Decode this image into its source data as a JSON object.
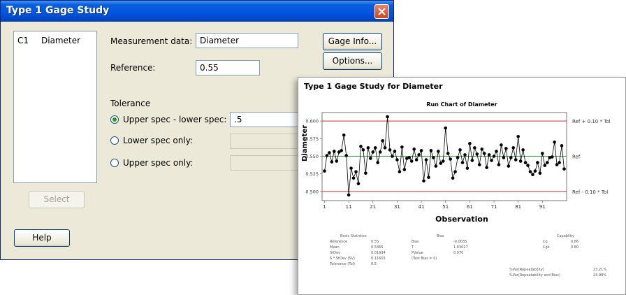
{
  "dialog": {
    "title": "Type 1 Gage Study",
    "variables": [
      {
        "col": "C1",
        "name": "Diameter"
      }
    ],
    "measurement_label": "Measurement data:",
    "measurement_value": "Diameter",
    "reference_label": "Reference:",
    "reference_value": "0.55",
    "tolerance_heading": "Tolerance",
    "opt_upper_lower": "Upper spec - lower spec:",
    "opt_upper_lower_value": ".5",
    "opt_lower_only": "Lower spec only:",
    "opt_upper_only": "Upper spec only:",
    "gage_info_label": "Gage Info...",
    "options_label": "Options...",
    "select_label": "Select",
    "help_label": "Help"
  },
  "graph": {
    "window_title": "Type 1 Gage Study for Diameter",
    "stats": {
      "basic_header": "Basic Statistics",
      "bias_header": "Bias",
      "capability_header": "Capability",
      "basic": [
        {
          "label": "Reference",
          "value": "0.55"
        },
        {
          "label": "Mean",
          "value": "0.5465"
        },
        {
          "label": "StDev",
          "value": "0.01934"
        },
        {
          "label": "6 * StDev (SV)",
          "value": "0.11603"
        },
        {
          "label": "Tolerance (Tol)",
          "value": "0.5"
        }
      ],
      "bias": [
        {
          "label": "Bias",
          "value": "-0.0035"
        },
        {
          "label": "T",
          "value": "1.83027"
        },
        {
          "label": "PValue",
          "value": "0.070"
        },
        {
          "label": "(Test Bias = 0)",
          "value": ""
        }
      ],
      "capability": [
        {
          "label": "Cg",
          "value": "0.86"
        },
        {
          "label": "Cgk",
          "value": "0.80"
        }
      ],
      "var": [
        {
          "label": "%Var(Repeatability)",
          "value": "23.21%"
        },
        {
          "label": "%Var(Repeatability and Bias)",
          "value": "24.98%"
        }
      ]
    }
  },
  "chart_data": {
    "type": "line",
    "title": "Run Chart of Diameter",
    "xlabel": "Observation",
    "ylabel": "Diameter",
    "xlim": [
      0,
      101
    ],
    "ylim": [
      0.487,
      0.612
    ],
    "xticks": [
      1,
      11,
      21,
      31,
      41,
      51,
      61,
      71,
      81,
      91
    ],
    "yticks": [
      0.5,
      0.525,
      0.55,
      0.575,
      0.6
    ],
    "ytick_labels": [
      "0.500",
      "0.525",
      "0.550",
      "0.575",
      "0.600"
    ],
    "reference_lines": [
      {
        "label": "Ref + 0.10 * Tol",
        "value": 0.6,
        "color": "#d62728"
      },
      {
        "label": "Ref",
        "value": 0.55,
        "color": "#2ca02c"
      },
      {
        "label": "Ref - 0.10 * Tol",
        "value": 0.5,
        "color": "#d62728"
      }
    ],
    "series": [
      {
        "values": [
          0.529,
          0.551,
          0.555,
          0.542,
          0.557,
          0.543,
          0.556,
          0.558,
          0.58,
          0.551,
          0.495,
          0.533,
          0.519,
          0.528,
          0.511,
          0.564,
          0.559,
          0.526,
          0.562,
          0.547,
          0.556,
          0.562,
          0.541,
          0.556,
          0.572,
          0.562,
          0.606,
          0.559,
          0.55,
          0.557,
          0.545,
          0.528,
          0.563,
          0.531,
          0.547,
          0.548,
          0.543,
          0.56,
          0.545,
          0.552,
          0.558,
          0.515,
          0.545,
          0.52,
          0.558,
          0.548,
          0.536,
          0.557,
          0.54,
          0.543,
          0.59,
          0.554,
          0.546,
          0.519,
          0.528,
          0.548,
          0.559,
          0.541,
          0.552,
          0.533,
          0.568,
          0.544,
          0.562,
          0.553,
          0.538,
          0.56,
          0.554,
          0.534,
          0.552,
          0.544,
          0.55,
          0.557,
          0.538,
          0.566,
          0.548,
          0.561,
          0.536,
          0.548,
          0.562,
          0.545,
          0.578,
          0.543,
          0.559,
          0.541,
          0.537,
          0.528,
          0.524,
          0.529,
          0.541,
          0.526,
          0.554,
          0.537,
          0.541,
          0.548,
          0.549,
          0.57,
          0.538,
          0.541,
          0.565,
          0.532
        ]
      }
    ],
    "grid": false
  }
}
